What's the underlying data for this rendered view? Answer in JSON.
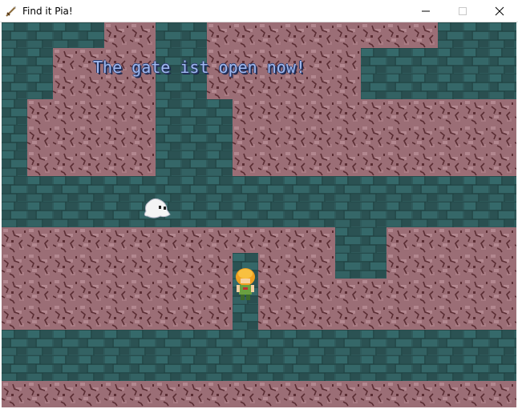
{
  "window": {
    "title": "Find it Pia!",
    "app_icon": "sword-icon",
    "controls": [
      "minimize-icon",
      "maximize-icon",
      "close-icon"
    ]
  },
  "game": {
    "message": "The gate ist open now!",
    "floor_color": "#2d5556",
    "wall_color": "#9b6e76",
    "wall_crack_color": "#5a2d33",
    "characters": [
      {
        "name": "player-pia",
        "description": "orange-haired girl in green tunic"
      },
      {
        "name": "ghost",
        "description": "small white ghost"
      }
    ]
  }
}
